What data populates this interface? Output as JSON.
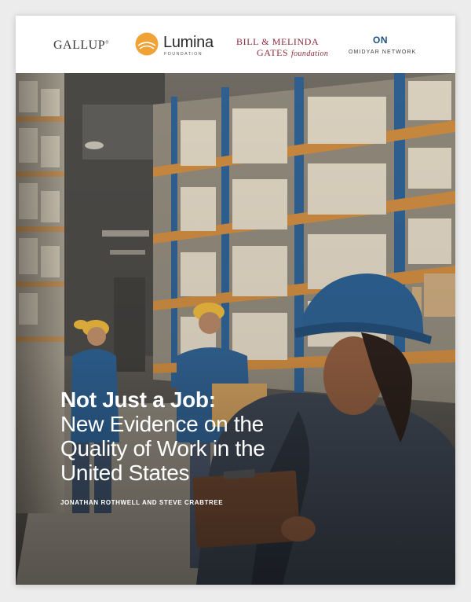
{
  "logos": {
    "gallup": "GALLUP",
    "lumina_name": "Lumina",
    "lumina_sub": "FOUNDATION",
    "gates_line1": "BILL & MELINDA",
    "gates_line2": "GATES",
    "gates_line2_suffix": "foundation",
    "omidyar_mark": "ON",
    "omidyar_name": "OMIDYAR NETWORK"
  },
  "cover": {
    "title_bold": "Not Just a Job:",
    "title_lines": [
      "New Evidence on the",
      "Quality of Work in the",
      "United States"
    ],
    "authors": "JONATHAN ROTHWELL AND STEVE CRABTREE"
  },
  "colors": {
    "lumina_orange": "#f0a234",
    "gates_red": "#8e2a3b",
    "omidyar_blue": "#1f4f7e",
    "hardhat_blue": "#2c5d8c",
    "hardhat_yellow": "#e2b13c"
  }
}
